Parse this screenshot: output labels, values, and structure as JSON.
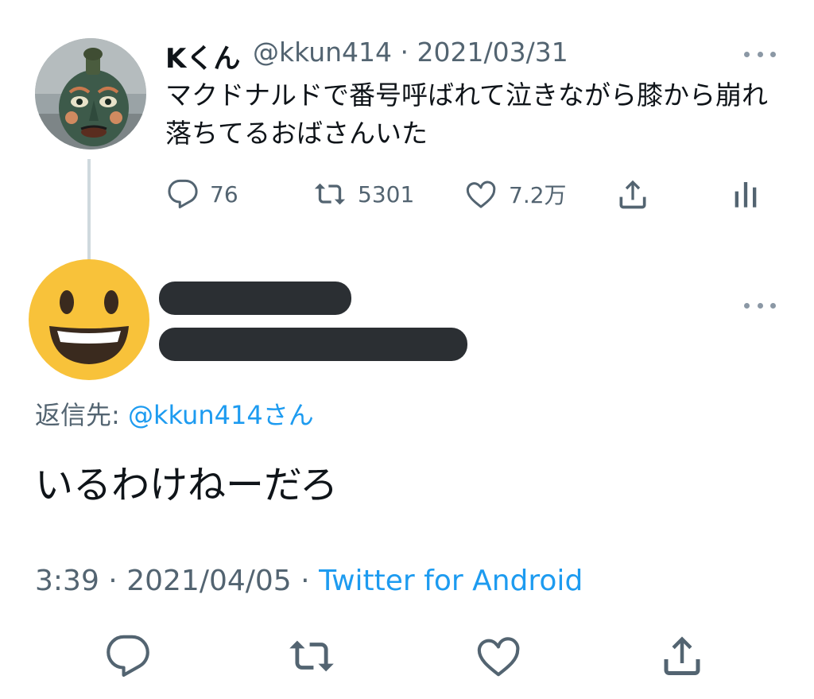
{
  "parent_tweet": {
    "author_name": "Kくん",
    "handle": "@kkun414",
    "separator": "·",
    "date": "2021/03/31",
    "text": "マクドナルドで番号呼ばれて泣きながら膝から崩れ落ちてるおばさんいた",
    "actions": {
      "reply_count": "76",
      "retweet_count": "5301",
      "like_count": "7.2万"
    }
  },
  "reply_tweet": {
    "reply_to_label": "返信先: ",
    "reply_to_mention": "@kkun414さん",
    "text": "いるわけねーだろ",
    "time": "3:39",
    "separator": "·",
    "date": "2021/04/05",
    "source": "Twitter for Android"
  },
  "colors": {
    "accent": "#1d9bf0",
    "secondary_text": "#536471",
    "redaction": "#2b2f33",
    "emoji_face": "#f8c23a"
  },
  "icons": {
    "reply": "reply-icon",
    "retweet": "retweet-icon",
    "like": "heart-icon",
    "share": "share-icon",
    "analytics": "analytics-icon",
    "more": "more-icon"
  }
}
